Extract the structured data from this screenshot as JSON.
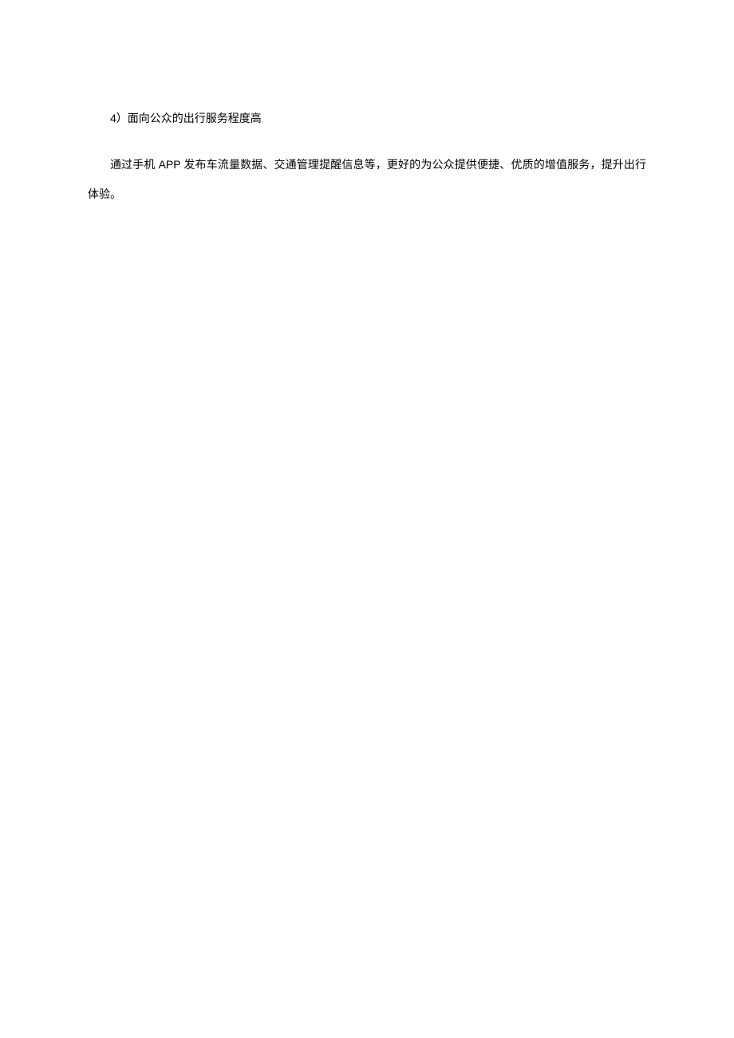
{
  "heading": "4）面向公众的出行服务程度高",
  "paragraph": "通过手机 APP 发布车流量数据、交通管理提醒信息等，更好的为公众提供便捷、优质的增值服务，提升出行体验。"
}
